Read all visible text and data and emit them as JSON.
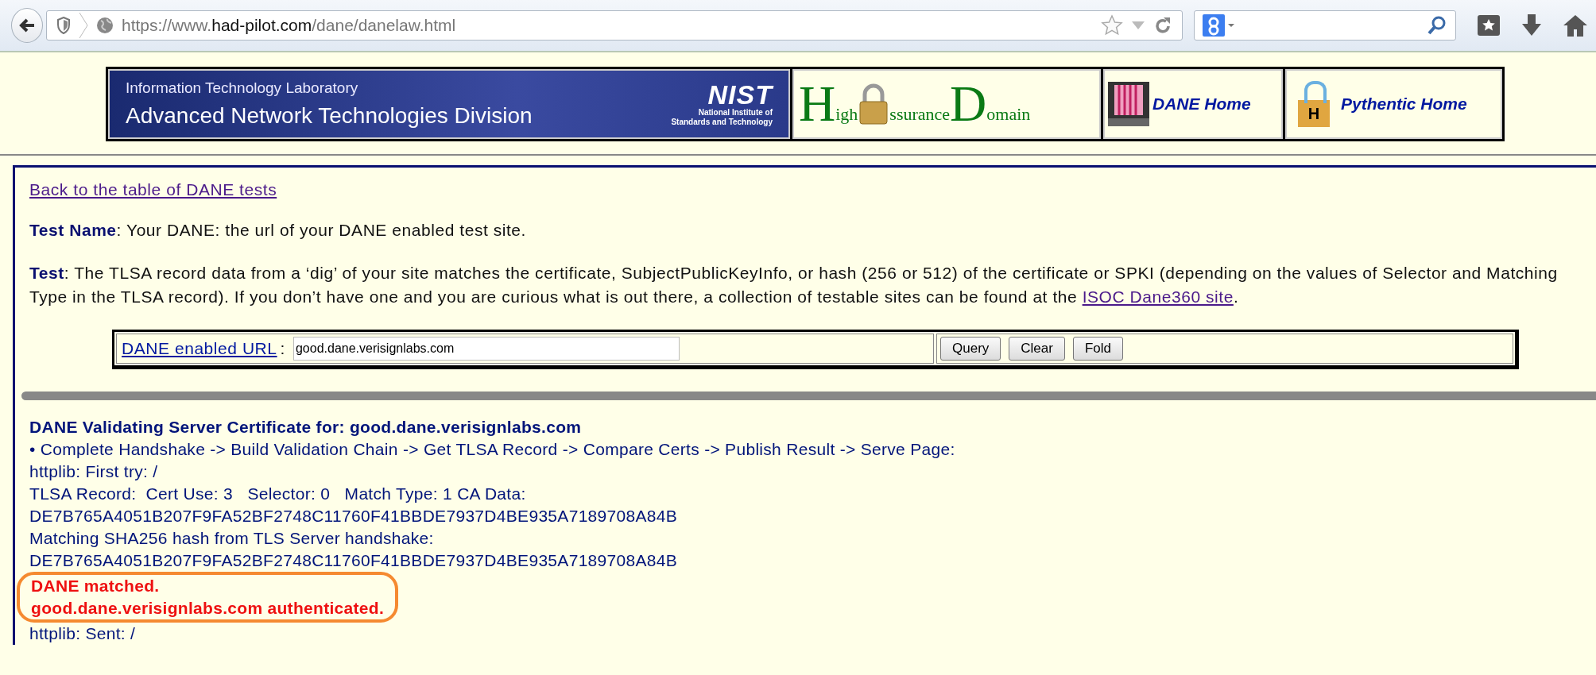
{
  "browser": {
    "url": [
      {
        "text": "https://www.",
        "kind": "dim"
      },
      {
        "text": "had-pilot.com",
        "kind": "host"
      },
      {
        "text": "/dane/danelaw.html",
        "kind": "dim"
      }
    ]
  },
  "banner": {
    "nist": {
      "lab": "Information Technology Laboratory",
      "division": "Advanced Network Technologies Division",
      "logo": "NIST",
      "institute": [
        "National Institute of",
        "Standards and Technology"
      ]
    },
    "had_logo": [
      {
        "text": "H",
        "kind": "initial"
      },
      {
        "text": "igh",
        "kind": "rest"
      },
      {
        "kind": "lock"
      },
      {
        "text": "ssurance",
        "kind": "rest"
      },
      {
        "text": "D",
        "kind": "initial"
      },
      {
        "text": "omain",
        "kind": "rest"
      }
    ],
    "dane_home": "DANE Home",
    "pythentic_home": "Pythentic Home",
    "pythentic_badge": "H"
  },
  "back_link": "Back to the table of DANE tests",
  "test_name": "**Test Name**: Your DANE: the url of your DANE enabled test site.",
  "test": {
    "text": "**Test**: The TLSA record data from a ‘dig’ of your site matches the certificate, SubjectPublicKeyInfo, or hash (256 or 512) of the certificate or SPKI (depending on the values of Selector and Matching Type in the TLSA record). If you don’t have one and you are curious what is out there, a collection of testable sites can be found at the",
    "link": "ISOC Dane360 site",
    "after": "."
  },
  "form": {
    "label": "DANE enabled URL",
    "colon": ":",
    "value": "good.dane.verisignlabs.com",
    "buttons": [
      "Query",
      "Clear",
      "Fold"
    ]
  },
  "result": {
    "heading": "DANE Validating Server Certificate for: good.dane.verisignlabs.com",
    "lines": [
      {
        "text": "• Complete Handshake -> Build Validation Chain -> Get TLSA Record -> Compare Certs -> Publish Result -> Serve Page:",
        "kind": "normal"
      },
      {
        "text": "httplib: First try: /",
        "kind": "normal"
      },
      {
        "text": "TLSA Record:  Cert Use: 3   Selector: 0   Match Type: 1 CA Data:",
        "kind": "normal"
      },
      {
        "text": "DE7B765A4051B207F9FA52BF2748C11760F41BBDE7937D4BE935A7189708A84B",
        "kind": "normal"
      },
      {
        "text": "Matching SHA256 hash from TLS Server handshake:",
        "kind": "normal"
      },
      {
        "text": "DE7B765A4051B207F9FA52BF2748C11760F41BBDE7937D4BE935A7189708A84B",
        "kind": "normal"
      },
      {
        "text": "DANE matched.",
        "kind": "alert"
      },
      {
        "text": "good.dane.verisignlabs.com authenticated.",
        "kind": "alert"
      },
      {
        "text": "httplib: Sent: /",
        "kind": "normal"
      }
    ]
  }
}
